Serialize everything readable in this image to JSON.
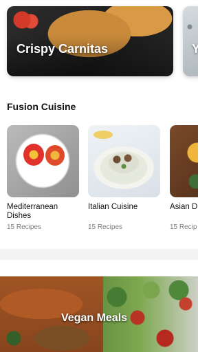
{
  "featured": {
    "items": [
      {
        "title": "Crispy Carnitas"
      },
      {
        "title": "Y"
      }
    ]
  },
  "fusion": {
    "title": "Fusion Cuisine",
    "items": [
      {
        "name": "Mediterranean Dishes",
        "count": "15 Recipes"
      },
      {
        "name": "Italian Cuisine",
        "count": "15 Recipes"
      },
      {
        "name": "Asian D",
        "count": "15 Recip"
      }
    ]
  },
  "banner": {
    "title": "Vegan Meals"
  }
}
